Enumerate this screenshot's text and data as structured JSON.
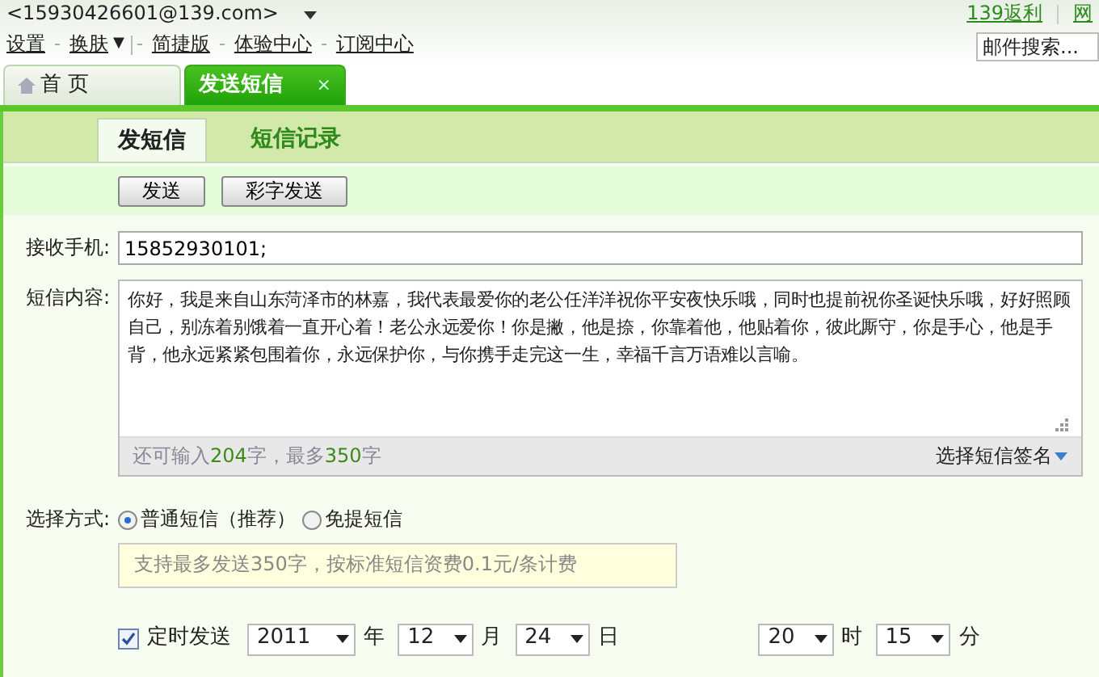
{
  "account": {
    "address": "<15930426601@139.com>"
  },
  "top_links": [
    {
      "label": "设置"
    },
    {
      "label": "换肤",
      "caret": "▼"
    },
    {
      "label": "简捷版"
    },
    {
      "label": "体验中心"
    },
    {
      "label": "订阅中心"
    }
  ],
  "right_links": [
    "139返利",
    "网"
  ],
  "search": {
    "placeholder": "邮件搜索..."
  },
  "tabs": [
    {
      "label": "首 页",
      "selected": false
    },
    {
      "label": "发送短信",
      "selected": true,
      "close": "×"
    }
  ],
  "subtabs": [
    {
      "label": "发短信",
      "selected": true
    },
    {
      "label": "短信记录",
      "selected": false
    }
  ],
  "buttons": [
    "发送",
    "彩字发送"
  ],
  "recipient": {
    "label": "接收手机:",
    "value": "15852930101;"
  },
  "message": {
    "label": "短信内容:",
    "value": "你好，我是来自山东菏泽市的林嘉，我代表最爱你的老公任洋洋祝你平安夜快乐哦，同时也提前祝你圣诞快乐哦，好好照顾自己，别冻着别饿着一直开心着！老公永远爱你！你是撇，他是捺，你靠着他，他贴着你，彼此厮守，你是手心，他是手背，他永远紧紧包围着你，永远保护你，与你携手走完这一生，幸福千言万语难以言喻。",
    "counter": {
      "prefix": "还可输入",
      "remaining": "204",
      "middle": "字，最多",
      "max": "350",
      "suffix": "字"
    },
    "signature": "选择短信签名"
  },
  "mode": {
    "label": "选择方式:",
    "options": [
      {
        "label": "普通短信（推荐）",
        "selected": true
      },
      {
        "label": "免提短信",
        "selected": false
      }
    ],
    "hint": "支持最多发送350字，按标准短信资费0.1元/条计费"
  },
  "schedule": {
    "label": "定时发送",
    "checked": true,
    "fields": [
      {
        "value": "2011",
        "unit": "年"
      },
      {
        "value": "12",
        "unit": "月"
      },
      {
        "value": "24",
        "unit": "日"
      },
      {
        "value": "20",
        "unit": "时"
      },
      {
        "value": "15",
        "unit": "分"
      }
    ]
  }
}
